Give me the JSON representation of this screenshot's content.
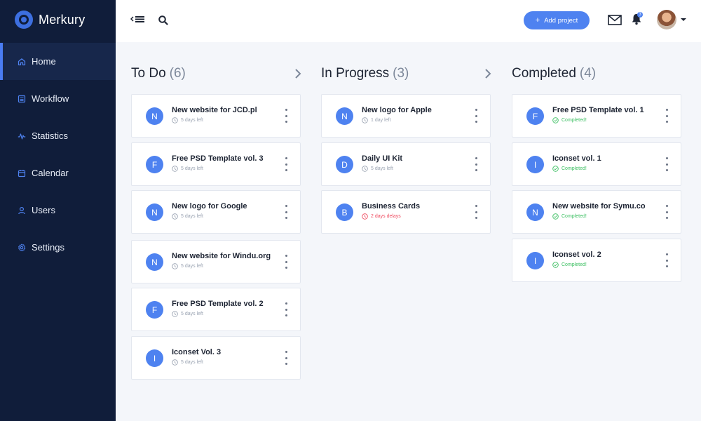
{
  "brand": {
    "name": "Merkury"
  },
  "colors": {
    "accent": "#4e82f0",
    "sidebar": "#101d3a",
    "completed": "#3bbf61",
    "late": "#ef4d62"
  },
  "sidebar": {
    "items": [
      {
        "label": "Home",
        "icon": "home-icon",
        "active": true
      },
      {
        "label": "Workflow",
        "icon": "list-icon",
        "active": false
      },
      {
        "label": "Statistics",
        "icon": "chart-line-icon",
        "active": false
      },
      {
        "label": "Calendar",
        "icon": "calendar-icon",
        "active": false
      },
      {
        "label": "Users",
        "icon": "user-icon",
        "active": false
      },
      {
        "label": "Settings",
        "icon": "gear-icon",
        "active": false
      }
    ]
  },
  "topbar": {
    "add_project_label": "Add project",
    "add_project_icon": "plus-icon",
    "notification_count": "3"
  },
  "columns": [
    {
      "title": "To Do",
      "count": "(6)",
      "cards": [
        {
          "initial": "N",
          "title": "New website for JCD.pl",
          "meta": "5 days left",
          "status": "pending"
        },
        {
          "initial": "F",
          "title": "Free PSD Template vol. 3",
          "meta": "5 days left",
          "status": "pending"
        },
        {
          "initial": "N",
          "title": "New logo for Google",
          "meta": "5 days left",
          "status": "pending"
        },
        {
          "initial": "N",
          "title": "New website for Windu.org",
          "meta": "5 days left",
          "status": "pending"
        },
        {
          "initial": "F",
          "title": "Free PSD Template vol. 2",
          "meta": "5 days left",
          "status": "pending"
        },
        {
          "initial": "I",
          "title": "Iconset Vol. 3",
          "meta": "5 days left",
          "status": "pending"
        }
      ]
    },
    {
      "title": "In Progress",
      "count": "(3)",
      "cards": [
        {
          "initial": "N",
          "title": "New logo for Apple",
          "meta": "1 day left",
          "status": "pending"
        },
        {
          "initial": "D",
          "title": "Daily UI Kit",
          "meta": "5 days left",
          "status": "pending"
        },
        {
          "initial": "B",
          "title": "Business Cards",
          "meta": "2 days delays",
          "status": "late"
        }
      ]
    },
    {
      "title": "Completed",
      "count": "(4)",
      "cards": [
        {
          "initial": "F",
          "title": "Free PSD Template vol. 1",
          "meta": "Completed!",
          "status": "done"
        },
        {
          "initial": "I",
          "title": "Iconset vol. 1",
          "meta": "Completed!",
          "status": "done"
        },
        {
          "initial": "N",
          "title": "New website for Symu.co",
          "meta": "Completed!",
          "status": "done"
        },
        {
          "initial": "I",
          "title": "Iconset vol. 2",
          "meta": "Completed!",
          "status": "done"
        }
      ]
    }
  ]
}
